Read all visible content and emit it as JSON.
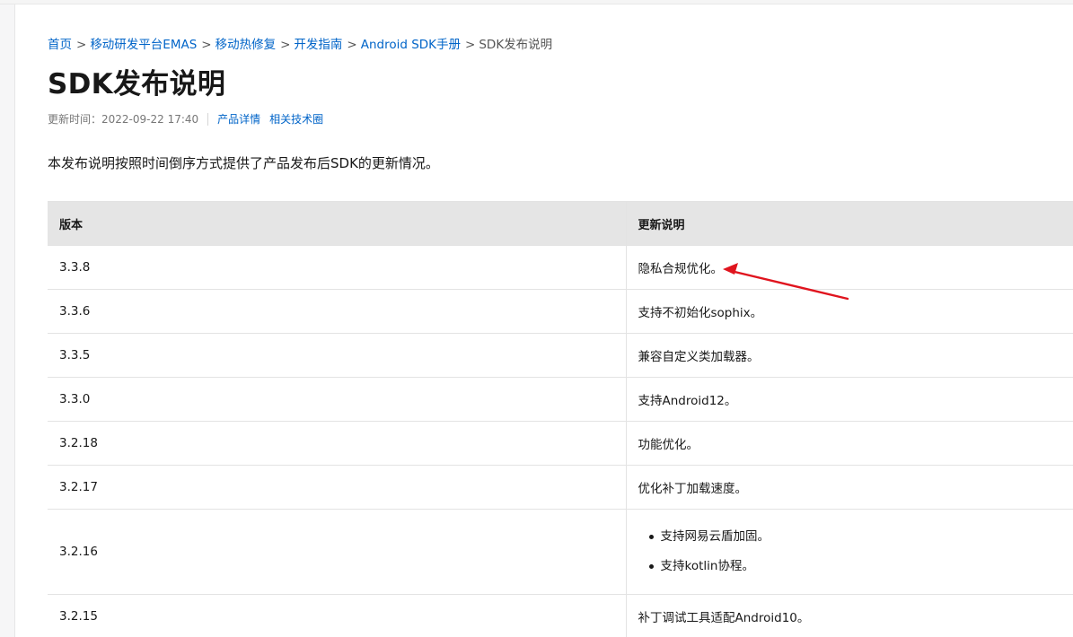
{
  "breadcrumb": {
    "items": [
      "首页",
      "移动研发平台EMAS",
      "移动热修复",
      "开发指南",
      "Android SDK手册"
    ],
    "separator": ">",
    "current": "SDK发布说明"
  },
  "title": "SDK发布说明",
  "meta": {
    "updated_label": "更新时间：",
    "updated_value": "2022-09-22 17:40",
    "links": [
      "产品详情",
      "相关技术圈"
    ]
  },
  "intro": "本发布说明按照时间倒序方式提供了产品发布后SDK的更新情况。",
  "table": {
    "headers": [
      "版本",
      "更新说明"
    ],
    "rows": [
      {
        "version": "3.3.8",
        "notes": [
          "隐私合规优化。"
        ]
      },
      {
        "version": "3.3.6",
        "notes": [
          "支持不初始化sophix。"
        ]
      },
      {
        "version": "3.3.5",
        "notes": [
          "兼容自定义类加载器。"
        ]
      },
      {
        "version": "3.3.0",
        "notes": [
          "支持Android12。"
        ]
      },
      {
        "version": "3.2.18",
        "notes": [
          "功能优化。"
        ]
      },
      {
        "version": "3.2.17",
        "notes": [
          "优化补丁加载速度。"
        ]
      },
      {
        "version": "3.2.16",
        "bullets": [
          "支持网易云盾加固。",
          "支持kotlin协程。"
        ]
      },
      {
        "version": "3.2.15",
        "notes": [
          "补丁调试工具适配Android10。"
        ]
      }
    ]
  },
  "colors": {
    "link": "#0064c8",
    "header_bg": "#e5e5e5",
    "annotation": "#e0141e"
  }
}
